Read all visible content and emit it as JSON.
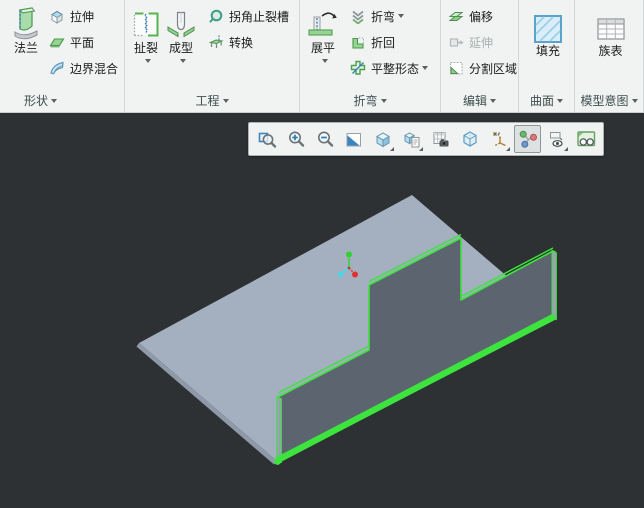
{
  "ribbon": {
    "groups": [
      {
        "label": "形状",
        "big": [
          {
            "label": "法兰"
          }
        ],
        "small": [
          {
            "label": "拉伸"
          },
          {
            "label": "平面"
          },
          {
            "label": "边界混合"
          }
        ]
      },
      {
        "label": "工程",
        "big": [
          {
            "label": "扯裂"
          },
          {
            "label": "成型"
          }
        ],
        "small": [
          {
            "label": "拐角止裂槽"
          },
          {
            "label": "转换"
          }
        ]
      },
      {
        "label": "折弯",
        "big": [
          {
            "label": "展平"
          }
        ],
        "small": [
          {
            "label": "折弯"
          },
          {
            "label": "折回"
          },
          {
            "label": "平整形态"
          }
        ]
      },
      {
        "label": "编辑",
        "small": [
          {
            "label": "偏移"
          },
          {
            "label": "延伸",
            "disabled": true
          },
          {
            "label": "分割区域"
          }
        ]
      },
      {
        "label": "曲面",
        "big": [
          {
            "label": "填充"
          }
        ]
      },
      {
        "label": "模型意图",
        "big": [
          {
            "label": "族表"
          }
        ]
      }
    ]
  },
  "graphics_toolbar": {
    "buttons": [
      "refit",
      "zoom-in",
      "zoom-out",
      "repaint",
      "display-style",
      "saved-orientations",
      "view-manager",
      "transparent-shading",
      "datum-display-filters",
      "spin-center",
      "annotation-display",
      "render-view"
    ],
    "active": "spin-center"
  },
  "viewport": {
    "background_color": "#2e3133",
    "selection_color": "#3de43d",
    "part": {
      "type": "sheet-metal-part",
      "top_face_color": "#a4afc0",
      "flange_face_color": "#5c6470",
      "thickness_edge_color": "#98a3b1",
      "selected_feature": "flange-wall"
    },
    "triad": {
      "x_axis_color": "#e03030",
      "y_axis_color": "#2ed32e",
      "z_axis_color": "#45d8e8"
    }
  }
}
